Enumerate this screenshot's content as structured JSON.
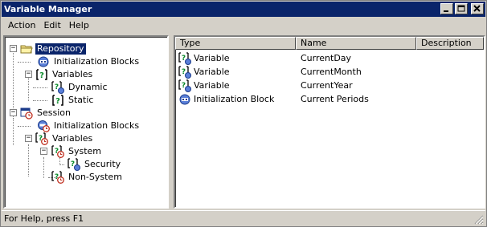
{
  "window": {
    "title": "Variable Manager"
  },
  "menu": {
    "items": [
      "Action",
      "Edit",
      "Help"
    ]
  },
  "tree": {
    "nodes": [
      {
        "label": "Repository",
        "icon": "folder-icon",
        "selected": true
      },
      {
        "label": "Initialization Blocks",
        "icon": "init-block-icon"
      },
      {
        "label": "Variables",
        "icon": "variable-icon"
      },
      {
        "label": "Dynamic",
        "icon": "dynamic-variable-icon"
      },
      {
        "label": "Static",
        "icon": "variable-icon"
      },
      {
        "label": "Session",
        "icon": "session-icon"
      },
      {
        "label": "Initialization Blocks",
        "icon": "session-init-block-icon"
      },
      {
        "label": "Variables",
        "icon": "session-variable-icon"
      },
      {
        "label": "System",
        "icon": "session-variable-icon"
      },
      {
        "label": "Security",
        "icon": "dynamic-variable-icon"
      },
      {
        "label": "Non-System",
        "icon": "session-variable-icon"
      }
    ]
  },
  "list": {
    "columns": [
      "Type",
      "Name",
      "Description"
    ],
    "rows": [
      {
        "type": "Variable",
        "name": "CurrentDay",
        "description": "",
        "icon": "dynamic-variable-icon"
      },
      {
        "type": "Variable",
        "name": "CurrentMonth",
        "description": "",
        "icon": "dynamic-variable-icon"
      },
      {
        "type": "Variable",
        "name": "CurrentYear",
        "description": "",
        "icon": "dynamic-variable-icon"
      },
      {
        "type": "Initialization Block",
        "name": "Current Periods",
        "description": "",
        "icon": "init-block-icon"
      }
    ]
  },
  "status": {
    "text": "For Help, press F1"
  },
  "colors": {
    "titlebar": "#0a246a",
    "chrome": "#d4d0c8",
    "selection": "#0a246a"
  }
}
